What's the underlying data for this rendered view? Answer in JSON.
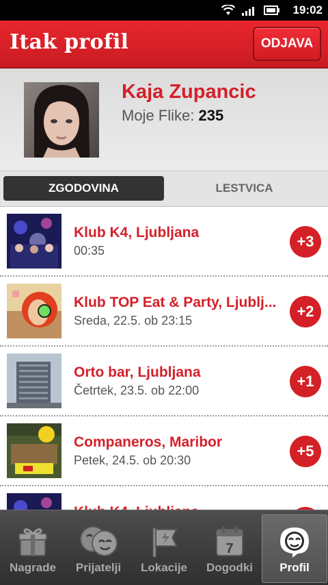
{
  "status_bar": {
    "time": "19:02",
    "icons": [
      "wifi-icon",
      "signal-icon",
      "battery-icon"
    ]
  },
  "header": {
    "title": "Itak profil",
    "logout_label": "ODJAVA"
  },
  "profile": {
    "name": "Kaja Zupancic",
    "flike_label": "Moje Flike:",
    "flike_count": "235"
  },
  "tabs": [
    {
      "label": "ZGODOVINA",
      "active": true
    },
    {
      "label": "LESTVICA",
      "active": false
    }
  ],
  "history": [
    {
      "title": "Klub K4, Ljubljana",
      "time": "00:35",
      "points": "+3"
    },
    {
      "title": "Klub TOP Eat & Party, Ljublj...",
      "time": "Sreda, 22.5. ob 23:15",
      "points": "+2"
    },
    {
      "title": "Orto bar, Ljubljana",
      "time": "Četrtek, 23.5. ob 22:00",
      "points": "+1"
    },
    {
      "title": "Companeros, Maribor",
      "time": "Petek, 24.5. ob 20:30",
      "points": "+5"
    },
    {
      "title": "Klub K4, Ljubljana",
      "time": "",
      "points": ""
    }
  ],
  "bottom_nav": [
    {
      "label": "Nagrade",
      "icon": "gift-icon"
    },
    {
      "label": "Prijatelji",
      "icon": "friends-icon"
    },
    {
      "label": "Lokacije",
      "icon": "location-flag-icon"
    },
    {
      "label": "Dogodki",
      "icon": "calendar-icon",
      "calendar_day": "7"
    },
    {
      "label": "Profil",
      "icon": "profile-icon",
      "active": true
    }
  ],
  "colors": {
    "accent": "#d4202a",
    "header": "#e8262e",
    "nav_bg": "#3c3c3c",
    "tab_active": "#333333"
  }
}
